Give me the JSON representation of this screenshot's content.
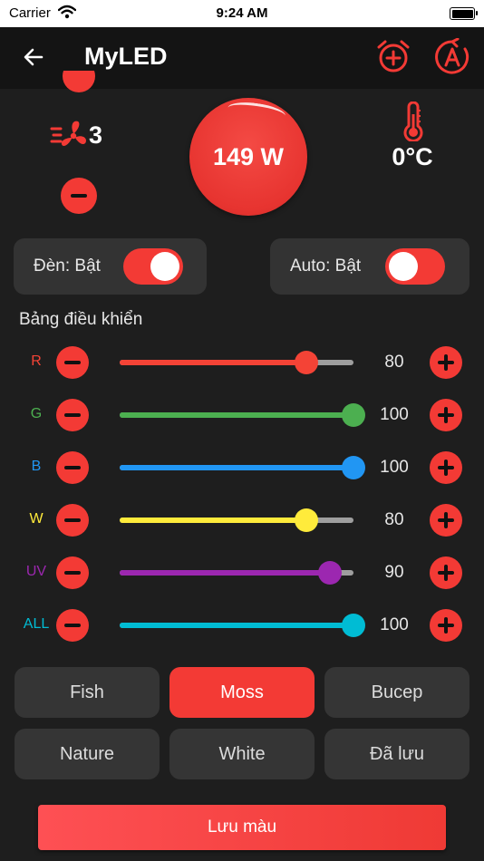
{
  "status_bar": {
    "carrier": "Carrier",
    "time": "9:24 AM"
  },
  "app_bar": {
    "title": "MyLED"
  },
  "fan": {
    "level": "3"
  },
  "power": {
    "text": "149 W"
  },
  "temperature": {
    "text": "0°C"
  },
  "toggles": [
    {
      "label": "Đèn: Bật",
      "on": true
    },
    {
      "label": "Auto: Bật",
      "on": true
    }
  ],
  "control_panel": {
    "title": "Bảng điều khiển",
    "channels": [
      {
        "label": "R",
        "value": 80,
        "display": "80",
        "color": "#f44336"
      },
      {
        "label": "G",
        "value": 100,
        "display": "100",
        "color": "#4caf50"
      },
      {
        "label": "B",
        "value": 100,
        "display": "100",
        "color": "#2196f3"
      },
      {
        "label": "W",
        "value": 80,
        "display": "80",
        "color": "#ffeb3b"
      },
      {
        "label": "UV",
        "value": 90,
        "display": "90",
        "color": "#9c27b0"
      },
      {
        "label": "ALL",
        "value": 100,
        "display": "100",
        "color": "#00bcd4"
      }
    ]
  },
  "presets": [
    {
      "label": "Fish",
      "active": false
    },
    {
      "label": "Moss",
      "active": true
    },
    {
      "label": "Bucep",
      "active": false
    },
    {
      "label": "Nature",
      "active": false
    },
    {
      "label": "White",
      "active": false
    },
    {
      "label": "Đã lưu",
      "active": false
    }
  ],
  "save_button": {
    "label": "Lưu màu"
  },
  "colors": {
    "accent": "#f33a35",
    "background": "#1e1e1e",
    "card": "#333333"
  },
  "icons": [
    "back-arrow-icon",
    "alarm-add-icon",
    "auto-mode-icon",
    "fan-icon",
    "thermometer-icon",
    "wifi-icon",
    "battery-icon"
  ]
}
